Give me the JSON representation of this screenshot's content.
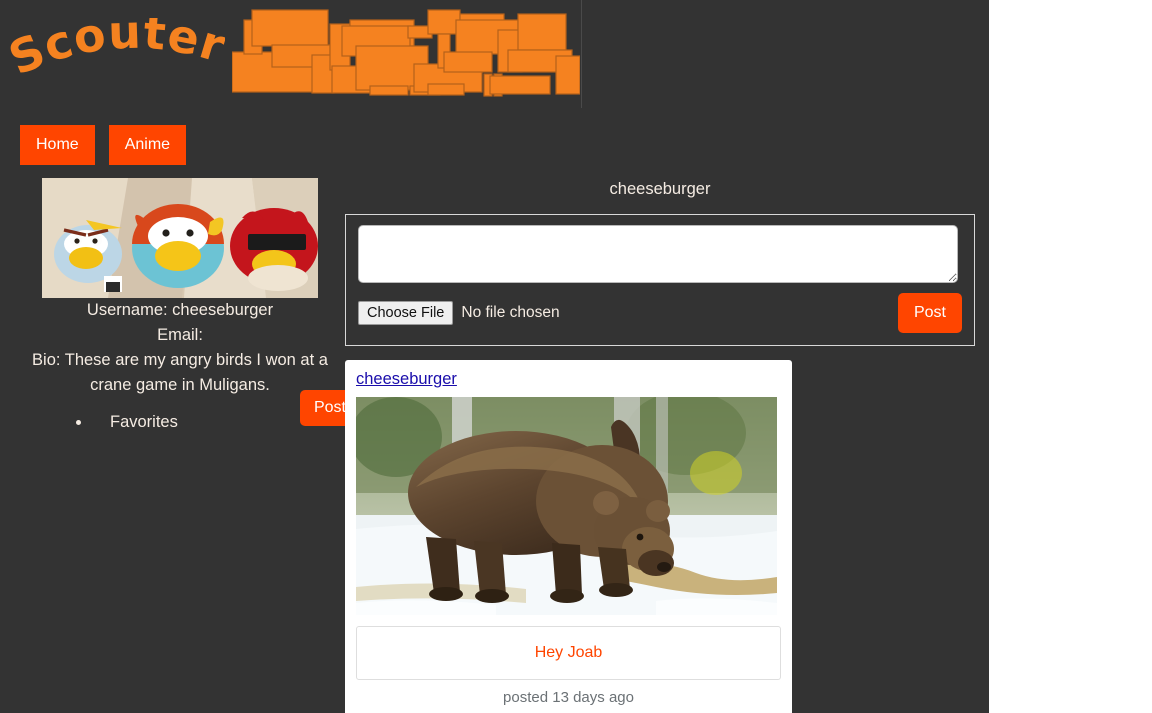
{
  "site": {
    "logo_text": "Scouter",
    "banner_alt": "orange-rectangle-collage",
    "accent_color": "#ff4500",
    "background_color": "#333333",
    "text_color": "#f5ece3"
  },
  "nav": {
    "items": [
      {
        "label": "Home"
      },
      {
        "label": "Anime"
      }
    ]
  },
  "sidebar": {
    "avatar_alt": "angry-birds-plush-photo",
    "username_line": "Username: cheeseburger",
    "email_line": "Email:",
    "bio_line": "Bio: These are my angry birds I won at a crane game in Muligans.",
    "favorites_label": "Favorites",
    "post_button_label": "Post"
  },
  "composer": {
    "title": "cheeseburger",
    "textarea_value": "",
    "textarea_placeholder": "",
    "choose_file_label": "Choose File",
    "file_status": "No file chosen",
    "post_button_label": "Post"
  },
  "feed": {
    "posts": [
      {
        "author": "cheeseburger",
        "image_alt": "brown-bear-walking-in-snow",
        "caption": "Hey Joab",
        "timestamp": "posted 13 days ago"
      }
    ]
  }
}
